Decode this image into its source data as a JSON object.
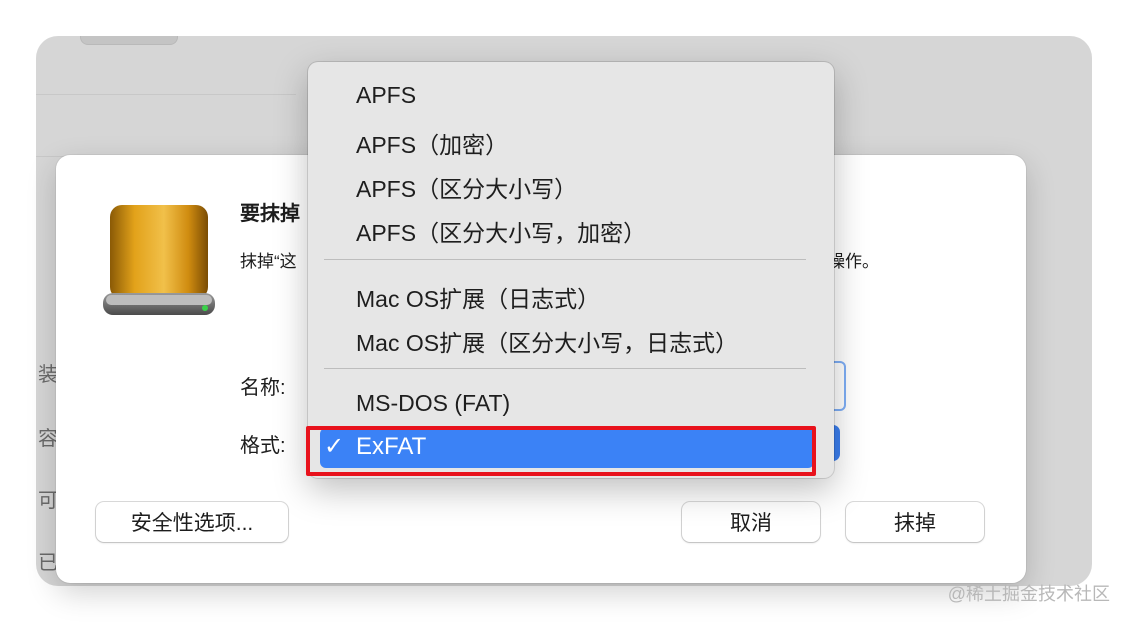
{
  "background": {
    "side_chars": [
      "装",
      "容",
      "可",
      "已"
    ]
  },
  "dialog": {
    "title": "要抹掉",
    "description": "抹掉“这",
    "description_tail": "操作。",
    "name_label": "名称:",
    "format_label": "格式:",
    "security_button": "安全性选项...",
    "cancel_button": "取消",
    "erase_button": "抹掉",
    "drive_icon": "external-drive-icon"
  },
  "menu": {
    "groups": [
      [
        "APFS",
        "APFS（加密）",
        "APFS（区分大小写）",
        "APFS（区分大小写，加密）"
      ],
      [
        "Mac OS扩展（日志式）",
        "Mac OS扩展（区分大小写，日志式）"
      ],
      [
        "MS-DOS (FAT)"
      ]
    ],
    "selected": "ExFAT",
    "check_icon": "✓"
  },
  "colors": {
    "selection": "#3b82f6",
    "highlight_box": "#e8121c",
    "drive": "#d89a14"
  },
  "watermark": "@稀土掘金技术社区"
}
